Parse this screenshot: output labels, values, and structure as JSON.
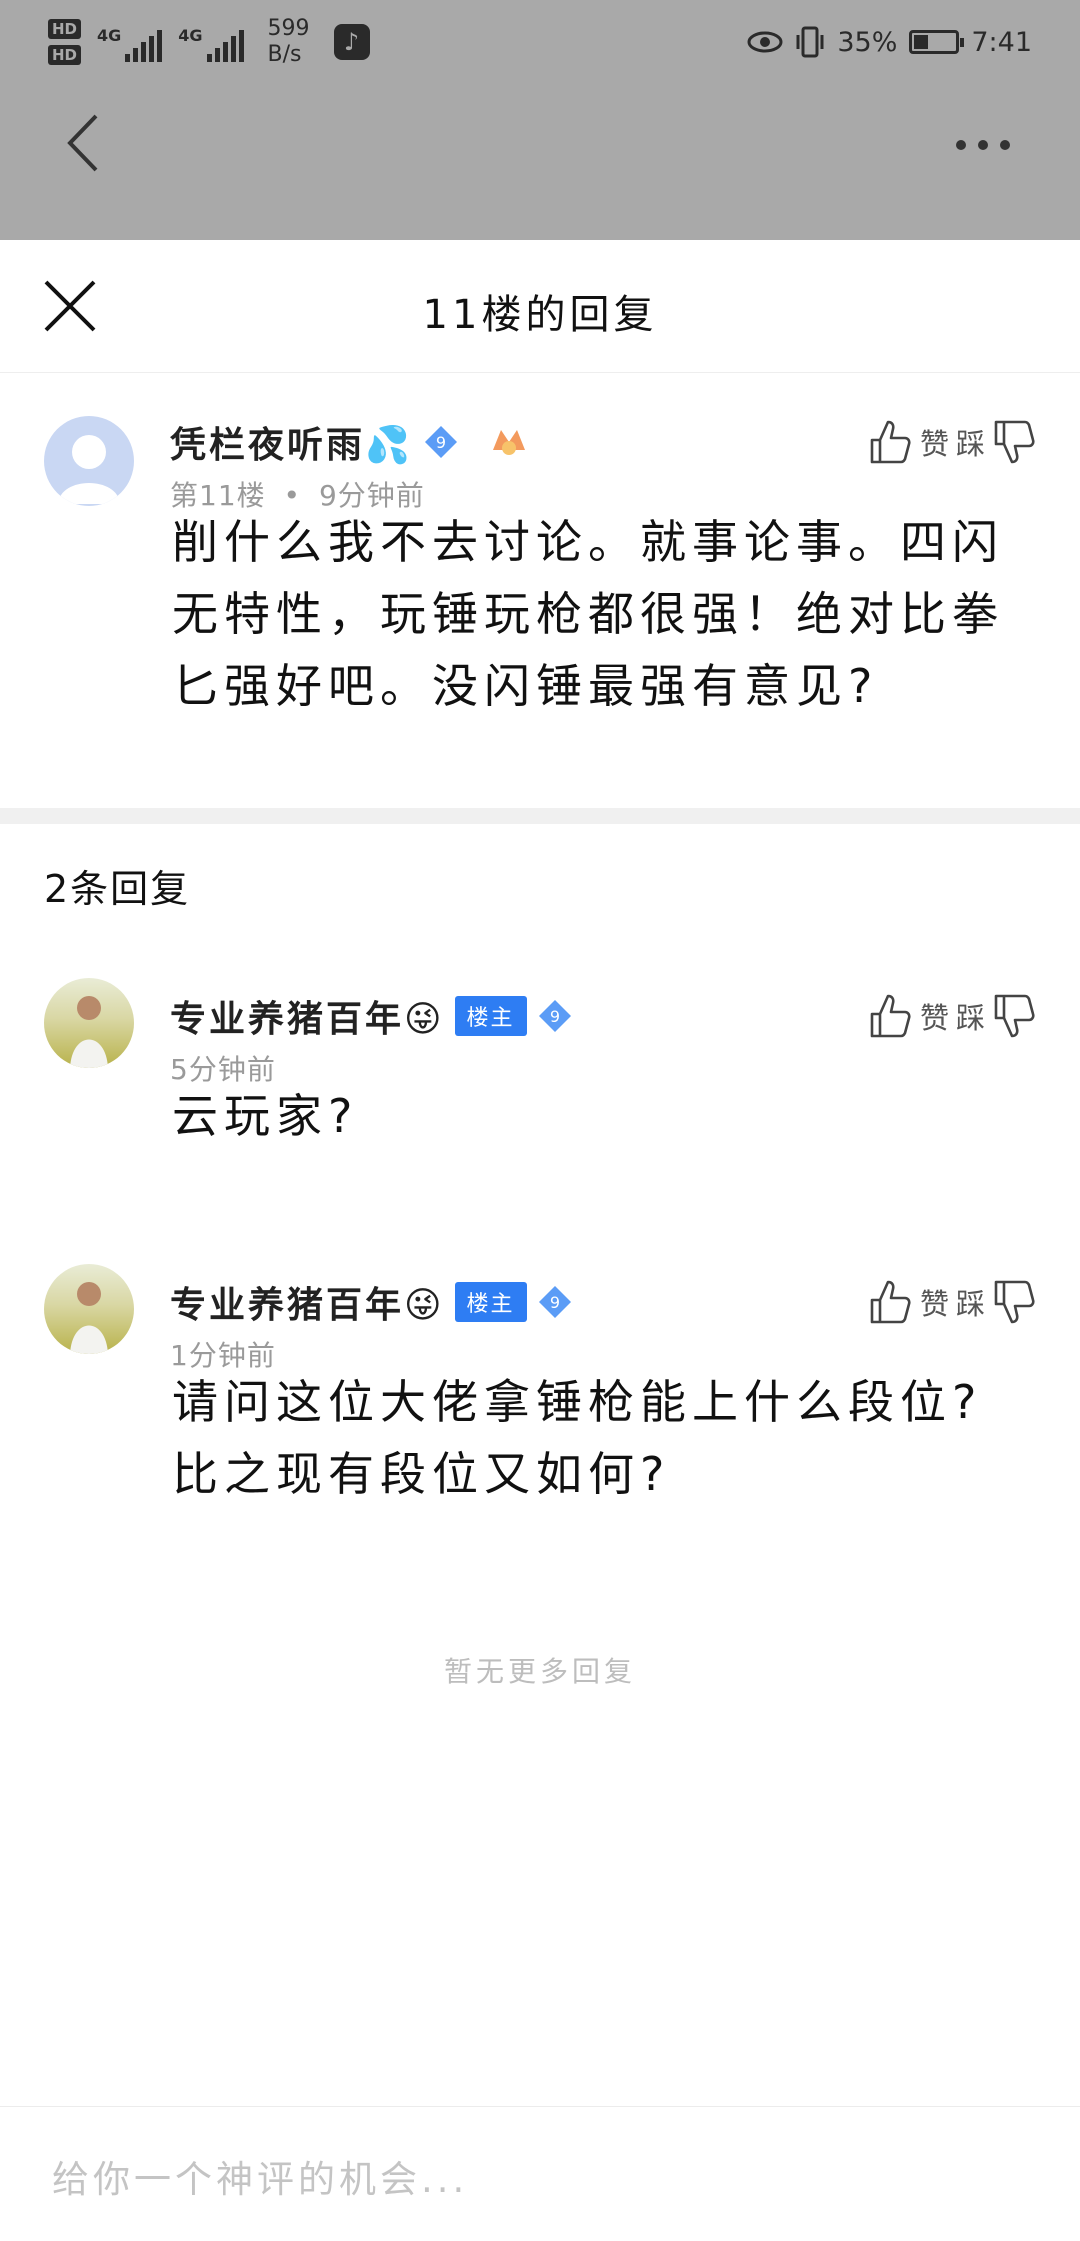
{
  "status_bar": {
    "hd1": "HD",
    "hd2": "HD",
    "net1": "4G",
    "net2": "4G",
    "speed_value": "599",
    "speed_unit": "B/s",
    "battery_percent": "35%",
    "battery_level": 0.35,
    "time": "7:41"
  },
  "sheet": {
    "title": "11楼的回复",
    "main_comment": {
      "username": "凭栏夜听雨💦",
      "level": "9",
      "floor": "第11楼",
      "separator": "•",
      "time": "9分钟前",
      "like_label": "赞",
      "dislike_label": "踩",
      "text": "削什么我不去讨论。就事论事。四闪无特性，玩锤玩枪都很强！绝对比拳匕强好吧。没闪锤最强有意见?"
    },
    "replies_count": "2条回复",
    "replies": [
      {
        "username": "专业养猪百年😜",
        "owner_badge": "楼主",
        "level": "9",
        "time": "5分钟前",
        "like_label": "赞",
        "dislike_label": "踩",
        "text": "云玩家?"
      },
      {
        "username": "专业养猪百年😜",
        "owner_badge": "楼主",
        "level": "9",
        "time": "1分钟前",
        "like_label": "赞",
        "dislike_label": "踩",
        "text": "请问这位大佬拿锤枪能上什么段位?比之现有段位又如何?"
      }
    ],
    "no_more": "暂无更多回复",
    "input_placeholder": "给你一个神评的机会..."
  },
  "colors": {
    "accent_blue": "#2e7df3",
    "dim_overlay": "#a9a9a9",
    "muted_text": "#9a9a9a"
  },
  "icons": [
    "back-arrow-icon",
    "more-icon",
    "close-icon",
    "thumb-up-icon",
    "thumb-down-icon",
    "level-diamond-icon",
    "medal-icon",
    "tiktok-icon"
  ]
}
